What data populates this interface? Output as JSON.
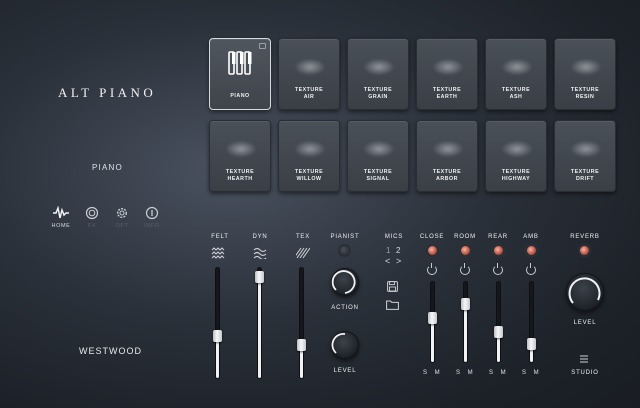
{
  "app": {
    "title": "ALT PIANO",
    "instrument": "PIANO",
    "maker": "WESTWOOD"
  },
  "nav": [
    {
      "label": "HOME",
      "icon": "waveform-icon",
      "active": true
    },
    {
      "label": "FX",
      "icon": "dial-icon",
      "active": false
    },
    {
      "label": "OPT",
      "icon": "gear-icon",
      "active": false
    },
    {
      "label": "INFO",
      "icon": "info-icon",
      "active": false
    }
  ],
  "tiles": [
    {
      "line1": "PIANO",
      "line2": "",
      "selected": true
    },
    {
      "line1": "TEXTURE",
      "line2": "AIR"
    },
    {
      "line1": "TEXTURE",
      "line2": "GRAIN"
    },
    {
      "line1": "TEXTURE",
      "line2": "EARTH"
    },
    {
      "line1": "TEXTURE",
      "line2": "ASH"
    },
    {
      "line1": "TEXTURE",
      "line2": "RESIN"
    },
    {
      "line1": "TEXTURE",
      "line2": "HEARTH"
    },
    {
      "line1": "TEXTURE",
      "line2": "WILLOW"
    },
    {
      "line1": "TEXTURE",
      "line2": "SIGNAL"
    },
    {
      "line1": "TEXTURE",
      "line2": "ARBOR"
    },
    {
      "line1": "TEXTURE",
      "line2": "HIGHWAY"
    },
    {
      "line1": "TEXTURE",
      "line2": "DRIFT"
    }
  ],
  "faders": {
    "felt": {
      "label": "FELT",
      "level": 0.38
    },
    "dyn": {
      "label": "DYN",
      "level": 0.92
    },
    "tex": {
      "label": "TEX",
      "level": 0.3
    }
  },
  "pianist": {
    "label": "PIANIST",
    "action_label": "ACTION",
    "level_label": "LEVEL"
  },
  "mics": {
    "label": "MICS",
    "pages": [
      "1",
      "2"
    ],
    "prev": "<",
    "next": ">"
  },
  "channels": [
    {
      "label": "CLOSE",
      "led_on": true,
      "level": 0.55,
      "sm": "S M"
    },
    {
      "label": "ROOM",
      "led_on": true,
      "level": 0.72,
      "sm": "S M"
    },
    {
      "label": "REAR",
      "led_on": true,
      "level": 0.38,
      "sm": "S M"
    },
    {
      "label": "AMB",
      "led_on": true,
      "level": 0.22,
      "sm": "S M"
    }
  ],
  "reverb": {
    "label": "REVERB",
    "level_label": "LEVEL",
    "studio_label": "STUDIO",
    "led_on": true
  },
  "colors": {
    "accent": "#f1f2f4",
    "led": "#c45a48",
    "tile": "#40454c"
  }
}
